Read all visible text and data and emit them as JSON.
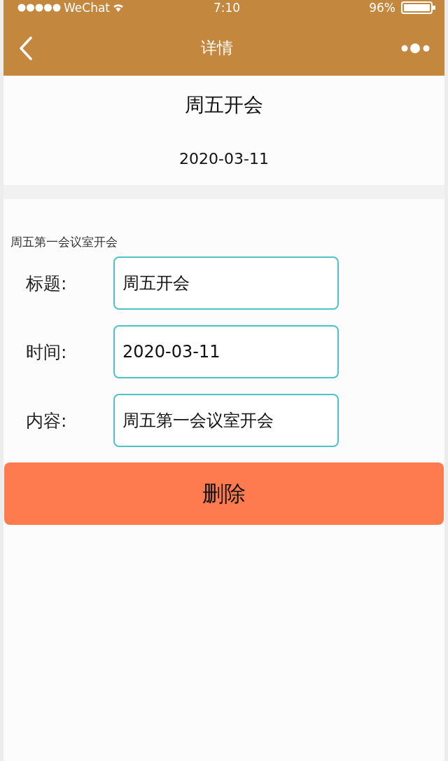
{
  "status_bar": {
    "carrier": "WeChat",
    "time": "7:10",
    "battery": "96%"
  },
  "nav_bar": {
    "title": "详情"
  },
  "header": {
    "title": "周五开会",
    "date": "2020-03-11"
  },
  "description": "周五第一会议室开会",
  "form": {
    "fields": [
      {
        "label": "标题:",
        "value": "周五开会"
      },
      {
        "label": "时间:",
        "value": "2020-03-11"
      },
      {
        "label": "内容:",
        "value": "周五第一会议室开会"
      }
    ]
  },
  "buttons": [
    {
      "label": "删除"
    }
  ]
}
